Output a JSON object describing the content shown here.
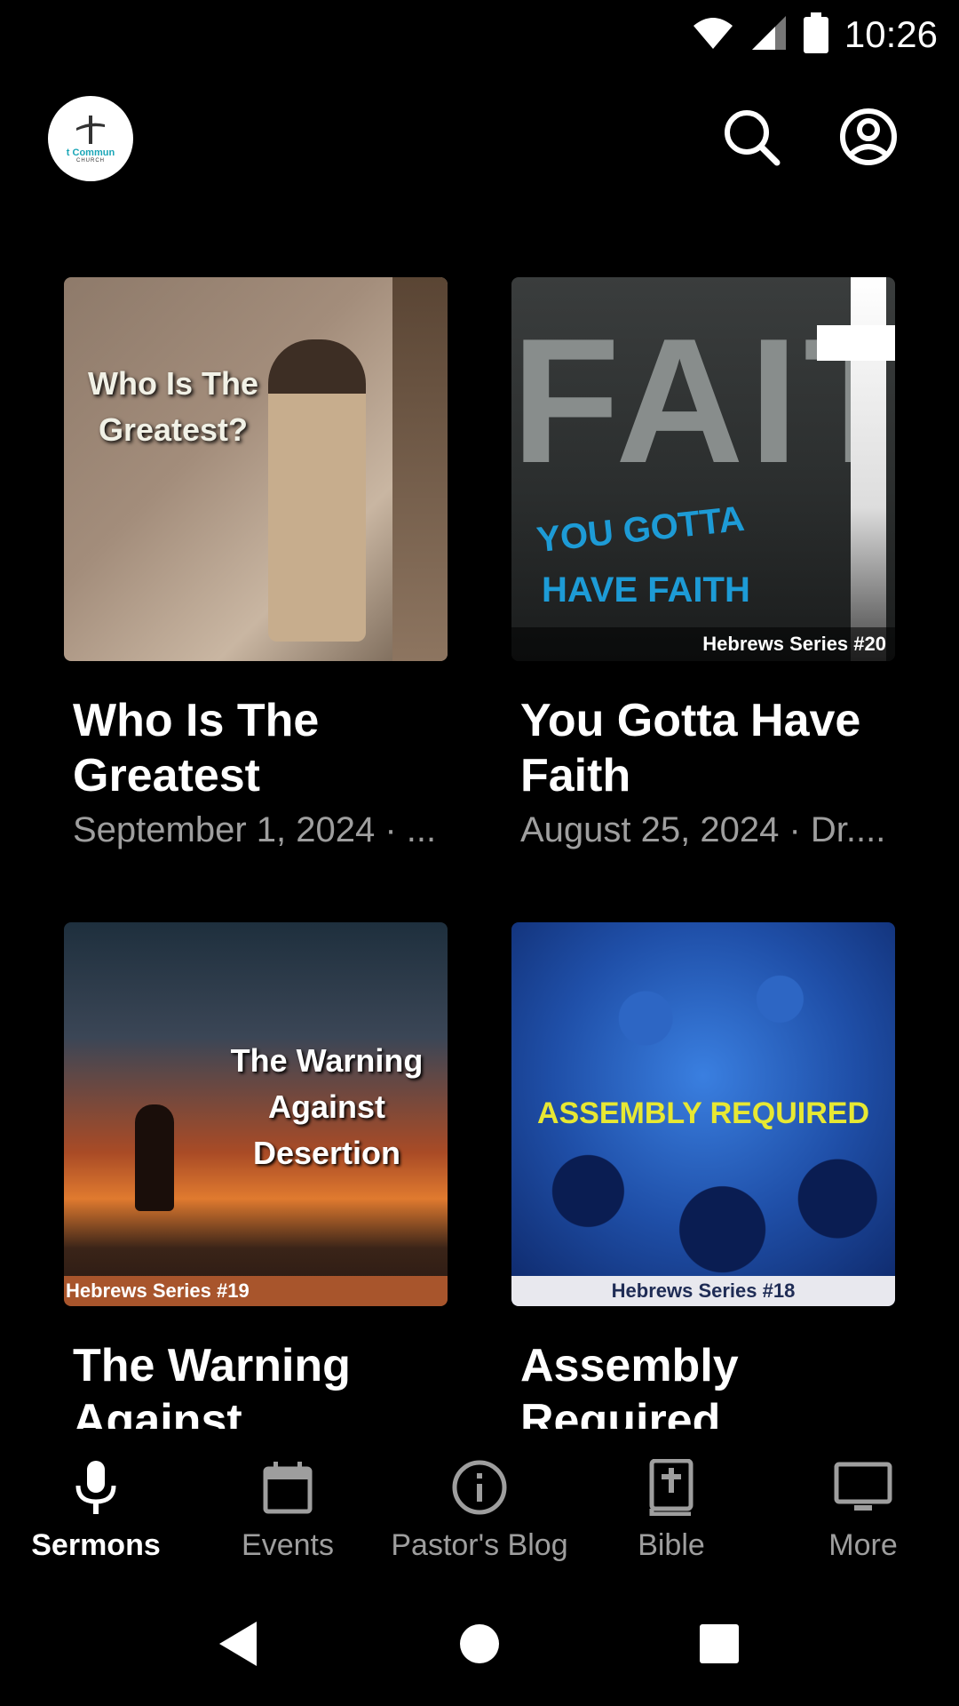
{
  "status_bar": {
    "time": "10:26"
  },
  "header": {
    "logo_text": "t Commun",
    "logo_subtext": "CHURCH"
  },
  "sermons": [
    {
      "title": "Who Is The Greatest",
      "meta": "September 1, 2024 · ...",
      "thumb_text": "Who Is The Greatest?"
    },
    {
      "title": "You Gotta Have Faith",
      "meta": "August 25, 2024 · Dr....",
      "thumb_big": "FAIT",
      "thumb_text_1": "YOU GOTTA",
      "thumb_text_2": "HAVE FAITH",
      "thumb_series": "Hebrews Series #20"
    },
    {
      "title": "The Warning Against Deserti...",
      "meta": "",
      "thumb_text": "The Warning Against Desertion",
      "thumb_series": "Hebrews Series #19"
    },
    {
      "title": "Assembly Required",
      "meta": "",
      "thumb_text": "ASSEMBLY REQUIRED",
      "thumb_series": "Hebrews Series #18"
    }
  ],
  "bottom_nav": {
    "items": [
      {
        "label": "Sermons",
        "icon": "microphone-icon",
        "active": true
      },
      {
        "label": "Events",
        "icon": "calendar-icon",
        "active": false
      },
      {
        "label": "Pastor's Blog",
        "icon": "info-icon",
        "active": false
      },
      {
        "label": "Bible",
        "icon": "bible-icon",
        "active": false
      },
      {
        "label": "More",
        "icon": "monitor-icon",
        "active": false
      }
    ]
  },
  "colors": {
    "background": "#000000",
    "inactive": "#9e9e9e",
    "active": "#ffffff"
  }
}
